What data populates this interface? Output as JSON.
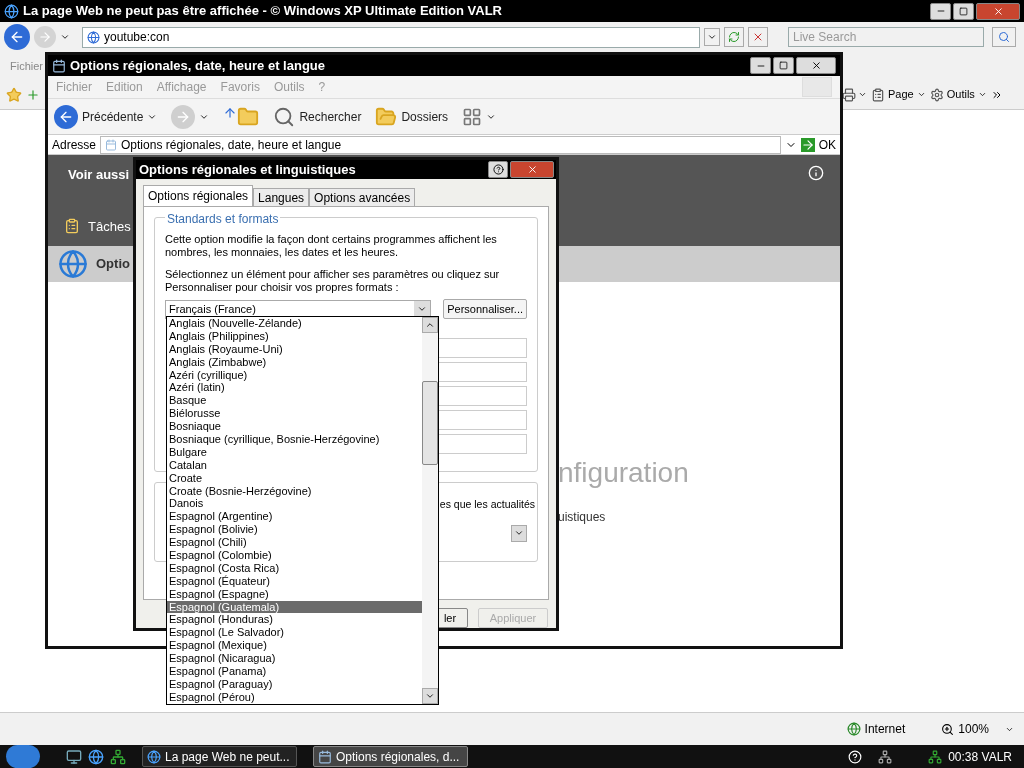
{
  "browser": {
    "title": "La page Web ne peut pas être affichée - © Windows XP Ultimate Edition VALR",
    "address": "youtube:con",
    "search_placeholder": "Live Search",
    "menu": [
      "Fichier"
    ],
    "toolbar": [
      "Page",
      "Outils"
    ],
    "status": {
      "zone": "Internet",
      "zoom": "100%"
    }
  },
  "explorer": {
    "title": "Options régionales, date, heure et langue",
    "menu": [
      "Fichier",
      "Edition",
      "Affichage",
      "Favoris",
      "Outils",
      "?"
    ],
    "toolbar": [
      {
        "kind": "back",
        "label": "Précédente"
      },
      {
        "kind": "forward"
      },
      {
        "kind": "up"
      },
      {
        "kind": "search",
        "label": "Rechercher"
      },
      {
        "kind": "folders",
        "label": "Dossiers"
      },
      {
        "kind": "views"
      }
    ],
    "address_label": "Adresse",
    "address": "Options régionales, date, heure et langue",
    "go": "OK",
    "sidebar": {
      "heading": "Voir aussi",
      "tasks": "Tâches",
      "item": "Optio"
    },
    "page_heading": "nfiguration",
    "page_link": "uistiques"
  },
  "dialog": {
    "title": "Options régionales et linguistiques",
    "tabs": [
      {
        "label": "Options régionales",
        "selected": true
      },
      {
        "label": "Langues",
        "selected": false
      },
      {
        "label": "Options avancées",
        "selected": false
      }
    ],
    "group": "Standards et formats",
    "description": "Cette option modifie la façon dont certains programmes affichent les nombres, les monnaies, les dates et les heures.",
    "instruction": "Sélectionnez un élément pour afficher ses paramètres ou cliquez sur Personnaliser pour choisir vos propres formats :",
    "select_value": "Français (France)",
    "customize": "Personnaliser...",
    "list": [
      {
        "label": "Anglais (Nouvelle-Zélande)",
        "selected": false
      },
      {
        "label": "Anglais (Philippines)",
        "selected": false
      },
      {
        "label": "Anglais (Royaume-Uni)",
        "selected": false
      },
      {
        "label": "Anglais (Zimbabwe)",
        "selected": false
      },
      {
        "label": "Azéri (cyrillique)",
        "selected": false
      },
      {
        "label": "Azéri (latin)",
        "selected": false
      },
      {
        "label": "Basque",
        "selected": false
      },
      {
        "label": "Biélorusse",
        "selected": false
      },
      {
        "label": "Bosniaque",
        "selected": false
      },
      {
        "label": "Bosniaque (cyrillique, Bosnie-Herzégovine)",
        "selected": false
      },
      {
        "label": "Bulgare",
        "selected": false
      },
      {
        "label": "Catalan",
        "selected": false
      },
      {
        "label": "Croate",
        "selected": false
      },
      {
        "label": "Croate (Bosnie-Herzégovine)",
        "selected": false
      },
      {
        "label": "Danois",
        "selected": false
      },
      {
        "label": "Espagnol (Argentine)",
        "selected": false
      },
      {
        "label": "Espagnol (Bolivie)",
        "selected": false
      },
      {
        "label": "Espagnol (Chili)",
        "selected": false
      },
      {
        "label": "Espagnol (Colombie)",
        "selected": false
      },
      {
        "label": "Espagnol (Costa Rica)",
        "selected": false
      },
      {
        "label": "Espagnol (Équateur)",
        "selected": false
      },
      {
        "label": "Espagnol (Espagne)",
        "selected": false
      },
      {
        "label": "Espagnol (Guatemala)",
        "selected": true
      },
      {
        "label": "Espagnol (Honduras)",
        "selected": false
      },
      {
        "label": "Espagnol (Le Salvador)",
        "selected": false
      },
      {
        "label": "Espagnol (Mexique)",
        "selected": false
      },
      {
        "label": "Espagnol (Nicaragua)",
        "selected": false
      },
      {
        "label": "Espagnol (Panama)",
        "selected": false
      },
      {
        "label": "Espagnol (Paraguay)",
        "selected": false
      },
      {
        "label": "Espagnol (Pérou)",
        "selected": false
      }
    ],
    "partial_text": "es que les actualités",
    "buttons": [
      {
        "label": "ler",
        "disabled": false
      },
      {
        "label": "Appliquer",
        "disabled": true
      }
    ]
  },
  "taskbar": {
    "tasks": [
      {
        "label": "La page Web ne peut...",
        "kind": "ie",
        "selected": false
      },
      {
        "label": "Options régionales, d...",
        "kind": "panel",
        "selected": true
      }
    ],
    "clock": "00:38 VALR"
  }
}
